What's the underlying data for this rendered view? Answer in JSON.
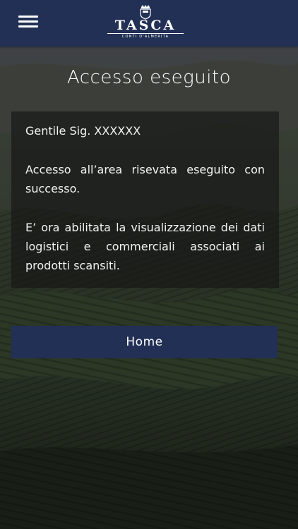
{
  "header": {
    "menu_icon": "hamburger-menu-icon",
    "logo": {
      "name": "TASCA",
      "subtitle": "CONTI D'ALMERITA",
      "crest_icon": "family-crest-icon"
    },
    "background_color": "#223055"
  },
  "page": {
    "title": "Accesso eseguito"
  },
  "message_card": {
    "greeting": "Gentile Sig. XXXXXX",
    "line1": "Accesso all’area risevata eseguito con successo.",
    "line2": "E’ ora abilitata la visualizzazione dei dati logistici e commerciali as­sociati ai prodotti scansiti."
  },
  "actions": {
    "home_label": "Home",
    "button_color": "#223055"
  }
}
